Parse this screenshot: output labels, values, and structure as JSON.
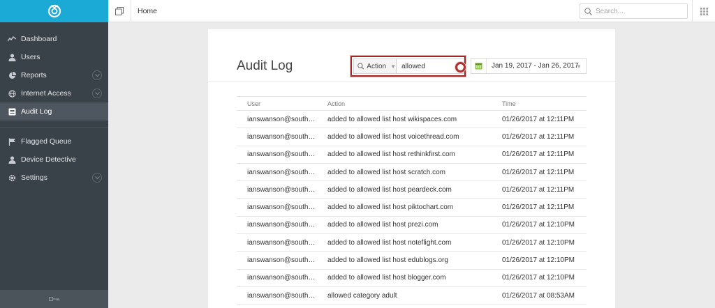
{
  "topbar": {
    "breadcrumb": "Home",
    "search_placeholder": "Search..."
  },
  "sidebar": {
    "items": [
      {
        "label": "Dashboard",
        "icon": "activity-icon"
      },
      {
        "label": "Users",
        "icon": "user-icon"
      },
      {
        "label": "Reports",
        "icon": "pie-chart-icon",
        "expandable": true
      },
      {
        "label": "Internet Access",
        "icon": "globe-icon",
        "expandable": true
      },
      {
        "label": "Audit Log",
        "icon": "list-icon",
        "active": true
      },
      {
        "label": "Flagged Queue",
        "icon": "flag-icon"
      },
      {
        "label": "Device Detective",
        "icon": "user-icon"
      },
      {
        "label": "Settings",
        "icon": "gear-icon",
        "expandable": true
      }
    ]
  },
  "main": {
    "title": "Audit Log",
    "filter": {
      "field": "Action",
      "value": "allowed"
    },
    "date_range": "Jan 19, 2017 - Jan 26, 2017",
    "table": {
      "columns": [
        "User",
        "Action",
        "Time"
      ],
      "rows": [
        [
          "ianswanson@southern...",
          "added to allowed list host wikispaces.com",
          "01/26/2017 at 12:11PM"
        ],
        [
          "ianswanson@southern...",
          "added to allowed list host voicethread.com",
          "01/26/2017 at 12:11PM"
        ],
        [
          "ianswanson@southern...",
          "added to allowed list host rethinkfirst.com",
          "01/26/2017 at 12:11PM"
        ],
        [
          "ianswanson@southern...",
          "added to allowed list host scratch.com",
          "01/26/2017 at 12:11PM"
        ],
        [
          "ianswanson@southern...",
          "added to allowed list host peardeck.com",
          "01/26/2017 at 12:11PM"
        ],
        [
          "ianswanson@southern...",
          "added to allowed list host piktochart.com",
          "01/26/2017 at 12:11PM"
        ],
        [
          "ianswanson@southern...",
          "added to allowed list host prezi.com",
          "01/26/2017 at 12:10PM"
        ],
        [
          "ianswanson@southern...",
          "added to allowed list host noteflight.com",
          "01/26/2017 at 12:10PM"
        ],
        [
          "ianswanson@southern...",
          "added to allowed list host edublogs.org",
          "01/26/2017 at 12:10PM"
        ],
        [
          "ianswanson@southern...",
          "added to allowed list host blogger.com",
          "01/26/2017 at 12:10PM"
        ],
        [
          "ianswanson@southern...",
          "allowed category adult",
          "01/26/2017 at 08:53AM"
        ]
      ]
    }
  },
  "colors": {
    "brand": "#1ba9d6",
    "sidebar_bg": "#3a4249",
    "highlight": "#a92424"
  }
}
